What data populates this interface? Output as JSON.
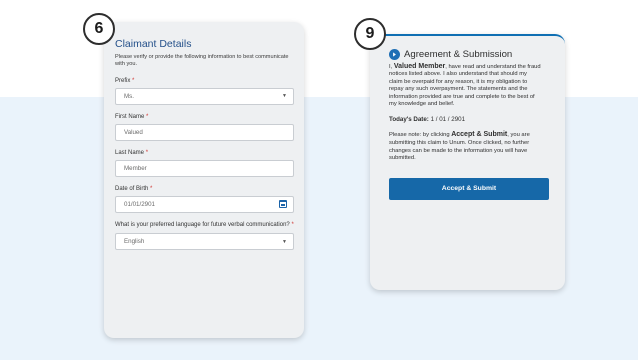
{
  "step_left": "6",
  "step_right": "9",
  "claimant": {
    "title": "Claimant Details",
    "intro": "Please verify or provide the following information to best communicate with you.",
    "prefix_label": "Prefix",
    "prefix_value": "Ms.",
    "first_name_label": "First Name",
    "first_name_value": "Valued",
    "last_name_label": "Last Name",
    "last_name_value": "Member",
    "dob_label": "Date of Birth",
    "dob_value": "01/01/2901",
    "language_label": "What is your preferred language for future verbal communication?",
    "language_value": "English",
    "required_mark": "*"
  },
  "agreement": {
    "title": "Agreement & Submission",
    "text_pre": "I,",
    "member_name": "Valued Member",
    "text_post": ", have read and understand the fraud notices listed above. I also understand that should my claim be overpaid for any reason, it is my obligation to repay any such overpayment. The statements and the information provided are true and complete to the best of my knowledge and belief.",
    "date_label": "Today's Date:",
    "date_value": "1 / 01 / 2901",
    "note_pre": "Please note: by clicking",
    "note_bold": "Accept & Submit",
    "note_post": ", you are submitting this claim to Unum. Once clicked, no further changes can be made to the information you will have submitted.",
    "button_label": "Accept & Submit"
  },
  "colors": {
    "band": "#eaf3fb",
    "title_blue": "#24508a",
    "button": "#1668a8",
    "required": "#d0312d"
  },
  "icons": [
    "chevron-down-icon",
    "calendar-icon",
    "arrow-right-circle-icon"
  ]
}
